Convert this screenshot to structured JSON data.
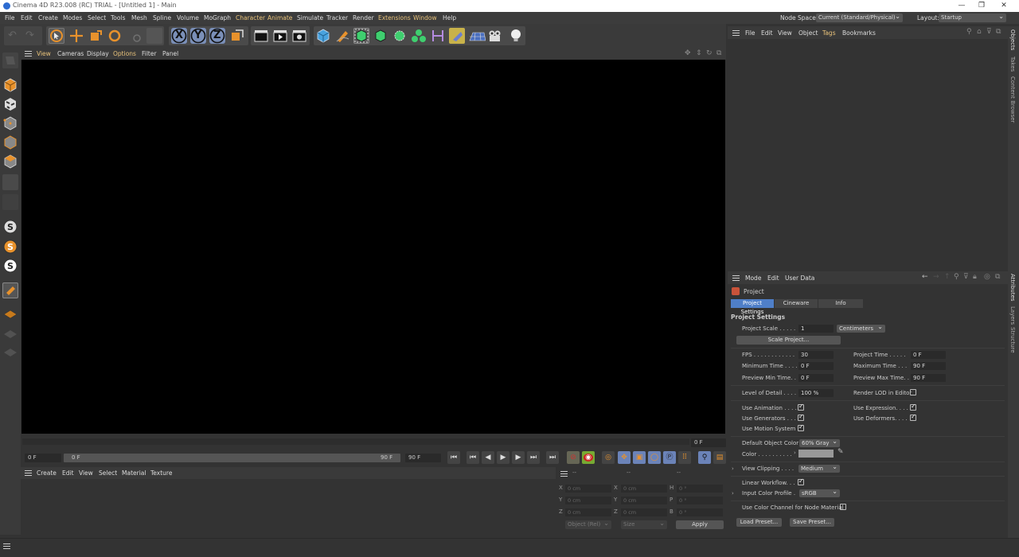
{
  "window": {
    "title": "Cinema 4D R23.008 (RC) TRIAL - [Untitled 1] - Main"
  },
  "menu": [
    "File",
    "Edit",
    "Create",
    "Modes",
    "Select",
    "Tools",
    "Mesh",
    "Spline",
    "Volume",
    "MoGraph",
    "Character",
    "Animate",
    "Simulate",
    "Tracker",
    "Render",
    "Extensions",
    "Window",
    "Help"
  ],
  "node_space": {
    "label": "Node Space:",
    "value": "Current (Standard/Physical)"
  },
  "layout": {
    "label": "Layout:",
    "value": "Startup"
  },
  "toolbar": {
    "x": "X",
    "y": "Y",
    "z": "Z"
  },
  "viewport_menu": [
    "View",
    "Cameras",
    "Display",
    "Options",
    "Filter",
    "Panel"
  ],
  "timeline": {
    "start": "0 F",
    "current": "0 F",
    "slider_start": "0 F",
    "slider_end": "90 F",
    "end": "90 F",
    "frame_right": "0 F"
  },
  "material_menu": [
    "Create",
    "Edit",
    "View",
    "Select",
    "Material",
    "Texture"
  ],
  "coords": {
    "dashes": [
      "--",
      "--",
      "--"
    ],
    "rows": [
      {
        "l1": "X",
        "v1": "0 cm",
        "l2": "X",
        "v2": "0 cm",
        "l3": "H",
        "v3": "0 °"
      },
      {
        "l1": "Y",
        "v1": "0 cm",
        "l2": "Y",
        "v2": "0 cm",
        "l3": "P",
        "v3": "0 °"
      },
      {
        "l1": "Z",
        "v1": "0 cm",
        "l2": "Z",
        "v2": "0 cm",
        "l3": "B",
        "v3": "0 °"
      }
    ],
    "mode": "Object (Rel)",
    "size": "Size",
    "apply": "Apply"
  },
  "objects_menu": [
    "File",
    "Edit",
    "View",
    "Object",
    "Tags",
    "Bookmarks"
  ],
  "right_tabs_top": [
    "Objects",
    "Takes",
    "Content Browser"
  ],
  "right_tabs_bottom": [
    "Attributes",
    "Layers",
    "Structure"
  ],
  "attributes_menu": [
    "Mode",
    "Edit",
    "User Data"
  ],
  "attributes": {
    "object": "Project",
    "tabs": [
      "Project Settings",
      "Cineware",
      "Info"
    ],
    "section": "Project Settings",
    "project_scale_label": "Project Scale . . . . .",
    "project_scale_value": "1",
    "project_scale_unit": "Centimeters",
    "scale_project_btn": "Scale Project...",
    "fps_label": "FPS . . . . . . . . . . . .",
    "fps_value": "30",
    "project_time_label": "Project Time . . . . .",
    "project_time_value": "0 F",
    "min_time_label": "Minimum Time . . . .",
    "min_time_value": "0 F",
    "max_time_label": "Maximum Time . . .",
    "max_time_value": "90 F",
    "prev_min_label": "Preview Min Time. .",
    "prev_min_value": "0 F",
    "prev_max_label": "Preview Max Time. .",
    "prev_max_value": "90 F",
    "lod_label": "Level of Detail . . . .",
    "lod_value": "100 %",
    "render_lod_label": "Render LOD in Editor",
    "use_anim_label": "Use Animation . . . .",
    "use_expr_label": "Use Expression. . . .",
    "use_gen_label": "Use Generators . . .",
    "use_def_label": "Use Deformers. . . .",
    "use_motion_label": "Use Motion System",
    "def_obj_color_label": "Default Object Color",
    "def_obj_color_value": "60% Gray",
    "color_label": "Color . . . . . . . . . .",
    "view_clipping_label": "View Clipping . . . .",
    "view_clipping_value": "Medium",
    "linear_wf_label": "Linear Workflow. . .",
    "input_profile_label": "Input Color Profile .",
    "input_profile_value": "sRGB",
    "use_color_channel_label": "Use Color Channel for Node Material",
    "load_preset": "Load Preset...",
    "save_preset": "Save Preset..."
  },
  "colors": {
    "accent": "#4f7fc8",
    "viewport": "#000000",
    "panel": "#333333"
  }
}
